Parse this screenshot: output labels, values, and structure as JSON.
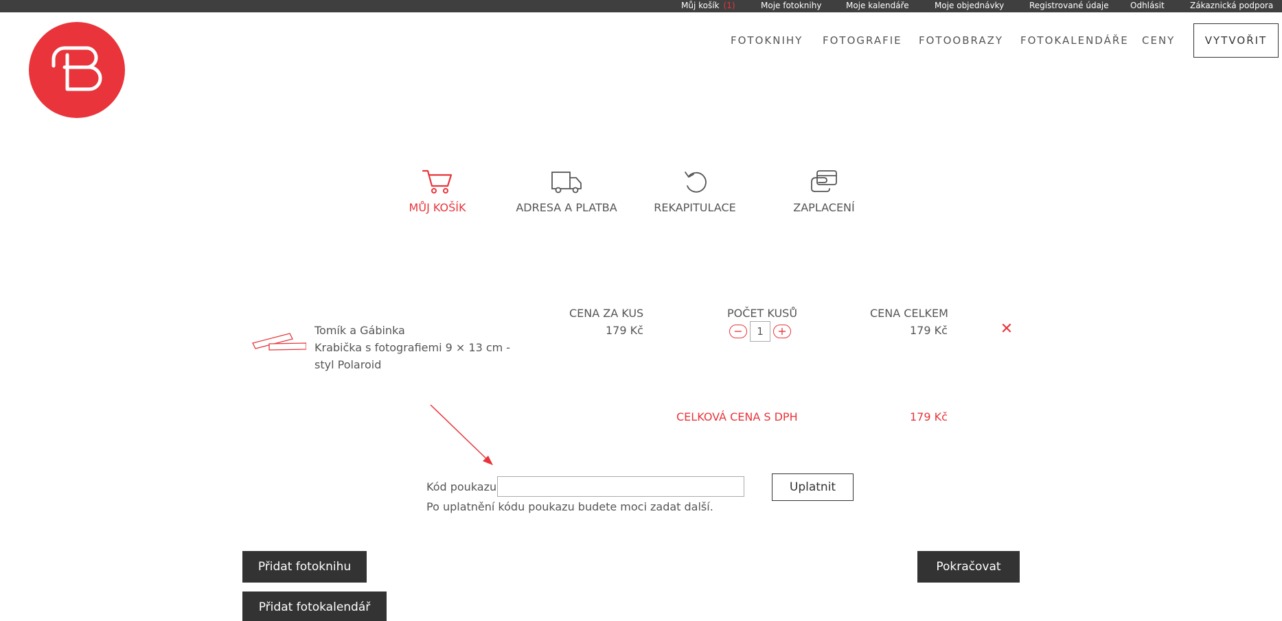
{
  "topbar": {
    "cart_label": "Můj košík",
    "cart_count": "(1)",
    "links": [
      "Moje fotoknihy",
      "Moje kalendáře",
      "Moje objednávky",
      "Registrované údaje",
      "Odhlásit",
      "Zákaznická podpora"
    ]
  },
  "logo": {
    "icon": "b-logo-icon",
    "color": "#e8343a"
  },
  "nav": {
    "items": [
      "FOTOKNIHY",
      "FOTOGRAFIE",
      "FOTOOBRAZY",
      "FOTOKALENDÁŘE",
      "CENY"
    ],
    "create_label": "VYTVOŘIT"
  },
  "steps": [
    {
      "label": "MŮJ KOŠÍK",
      "icon": "cart-icon",
      "active": true
    },
    {
      "label": "ADRESA A PLATBA",
      "icon": "truck-icon",
      "active": false
    },
    {
      "label": "REKAPITULACE",
      "icon": "refresh-icon",
      "active": false
    },
    {
      "label": "ZAPLACENÍ",
      "icon": "card-icon",
      "active": false
    }
  ],
  "cart": {
    "headers": {
      "unit_price": "CENA ZA KUS",
      "quantity": "POČET KUSŮ",
      "total": "CENA CELKEM"
    },
    "item": {
      "name": "Tomík a Gábinka",
      "desc_line1": "Krabička s fotografiemi 9 × 13 cm -",
      "desc_line2": "styl Polaroid",
      "unit_price": "179 Kč",
      "quantity": "1",
      "total": "179 Kč",
      "minus": "−",
      "plus": "+",
      "remove": "✕"
    },
    "grand_total_label": "CELKOVÁ CENA S DPH",
    "grand_total": "179 Kč"
  },
  "voucher": {
    "label": "Kód poukazu",
    "value": "",
    "placeholder": "",
    "apply_label": "Uplatnit",
    "hint": "Po uplatnění kódu poukazu budete moci zadat další."
  },
  "actions": {
    "add_photobook": "Přidat fotoknihu",
    "add_calendar": "Přidat fotokalendář",
    "continue": "Pokračovat"
  },
  "colors": {
    "accent": "#e8343a",
    "dark": "#333333",
    "topbar": "#3f3f3f"
  }
}
